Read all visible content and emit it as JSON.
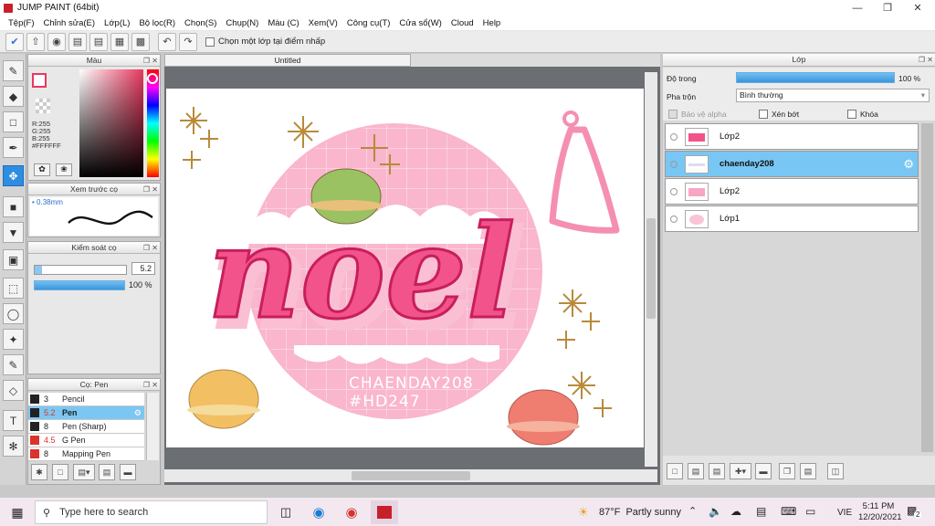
{
  "window": {
    "title": "JUMP PAINT (64bit)"
  },
  "menu": [
    "Tệp(F)",
    "Chỉnh sửa(E)",
    "Lớp(L)",
    "Bộ lọc(R)",
    "Chọn(S)",
    "Chụp(N)",
    "Màu (C)",
    "Xem(V)",
    "Công cụ(T)",
    "Cửa sổ(W)",
    "Cloud",
    "Help"
  ],
  "toolbar": {
    "checkbox_label": "Chọn một lớp tại điểm nhấp"
  },
  "color_panel": {
    "title": "Màu",
    "r": "R:255",
    "g": "G:255",
    "b": "B:255",
    "hex": "#FFFFFF",
    "fg": "#e8385e",
    "bg": "#ffffff"
  },
  "brush_preview": {
    "title": "Xem trước cọ",
    "size": "0.38mm"
  },
  "brush_control": {
    "title": "Kiểm soát cọ",
    "size_value": "5.2",
    "opacity_value": "100 %",
    "opacity": 1.0
  },
  "brush_list": {
    "title": "Cọ: Pen",
    "items": [
      {
        "size": "3",
        "name": "Pencil",
        "color": "#222222"
      },
      {
        "size": "5.2",
        "name": "Pen",
        "color": "#222222"
      },
      {
        "size": "8",
        "name": "Pen (Sharp)",
        "color": "#222222"
      },
      {
        "size": "4.5",
        "name": "G Pen",
        "color": "#d9342b"
      },
      {
        "size": "8",
        "name": "Mapping Pen",
        "color": "#d9342b"
      }
    ]
  },
  "canvas": {
    "tab_title": "Untitled",
    "art_text_main": "noel",
    "art_text_handle": "CHAENDAY208",
    "art_text_tag": "#HD247"
  },
  "layers_panel": {
    "title": "Lớp",
    "opacity_label": "Độ trong",
    "opacity_value": "100 %",
    "opacity": 1.0,
    "blend_label": "Pha trộn",
    "blend_value": "Bình thường",
    "protect_alpha": "Bảo vệ alpha",
    "clipping": "Xén bớt",
    "lock": "Khóa",
    "layers": [
      {
        "name": "Lớp2",
        "selected": false
      },
      {
        "name": "chaenday208",
        "selected": true
      },
      {
        "name": "Lớp2",
        "selected": false
      },
      {
        "name": "Lớp1",
        "selected": false
      }
    ]
  },
  "taskbar": {
    "search_placeholder": "Type here to search",
    "weather": "87°F  Partly sunny",
    "lang": "VIE",
    "time": "5:11 PM",
    "date": "12/20/2021",
    "notifications": "2"
  }
}
